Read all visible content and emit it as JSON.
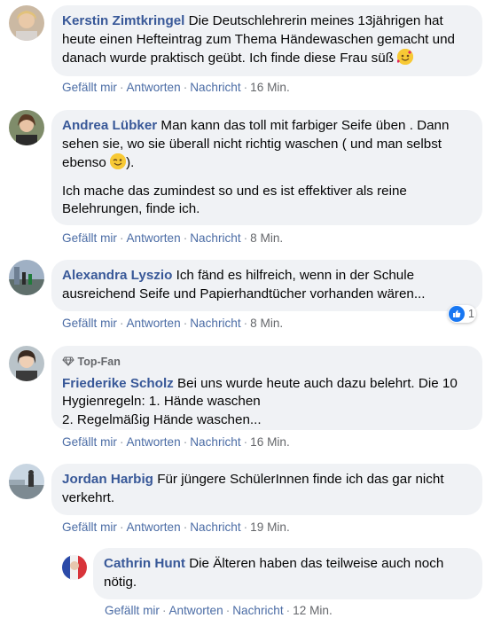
{
  "comments": [
    {
      "name": "Kerstin Zimtkringel",
      "text": "Die Deutschlehrerin meines 13jährigen hat heute einen Hefteintrag zum Thema Händewaschen gemacht und danach wurde praktisch geübt. Ich finde diese Frau süß",
      "emoji": "smiling-face-with-hearts",
      "actions": {
        "like": "Gefällt mir",
        "reply": "Antworten",
        "message": "Nachricht",
        "time": "16 Min."
      }
    },
    {
      "name": "Andrea Lübker",
      "text": "Man kann das toll mit farbiger Seife üben . Dann sehen sie, wo sie überall nicht richtig waschen ( und man selbst ebenso",
      "text_end": ").",
      "emoji": "winking-face",
      "text2": "Ich mache das zumindest so und es ist effektiver als reine Belehrungen, finde ich.",
      "actions": {
        "like": "Gefällt mir",
        "reply": "Antworten",
        "message": "Nachricht",
        "time": "8 Min."
      }
    },
    {
      "name": "Alexandra Lyszio",
      "text": "Ich fänd es hilfreich, wenn in der Schule ausreichend Seife und Papierhandtücher vorhanden wären...",
      "reaction_count": "1",
      "actions": {
        "like": "Gefällt mir",
        "reply": "Antworten",
        "message": "Nachricht",
        "time": "8 Min."
      }
    },
    {
      "badge": "Top-Fan",
      "name": "Friederike Scholz",
      "text": "Bei uns wurde heute auch dazu belehrt. Die 10 Hygienregeln: 1. Hände waschen",
      "text2": "2. Regelmäßig Hände waschen...",
      "actions": {
        "like": "Gefällt mir",
        "reply": "Antworten",
        "message": "Nachricht",
        "time": "16 Min."
      }
    },
    {
      "name": "Jordan Harbig",
      "text": "Für jüngere SchülerInnen finde ich das gar nicht verkehrt.",
      "actions": {
        "like": "Gefällt mir",
        "reply": "Antworten",
        "message": "Nachricht",
        "time": "19 Min."
      }
    },
    {
      "name": "Cathrin Hunt",
      "text": "Die Älteren haben das teilweise auch noch nötig.",
      "actions": {
        "like": "Gefällt mir",
        "reply": "Antworten",
        "message": "Nachricht",
        "time": "12 Min."
      }
    }
  ],
  "separator": "·",
  "colors": {
    "bubble": "#f0f2f5",
    "name": "#385898",
    "link": "#4b6ca5",
    "meta": "#65676b",
    "like": "#1877f2"
  }
}
